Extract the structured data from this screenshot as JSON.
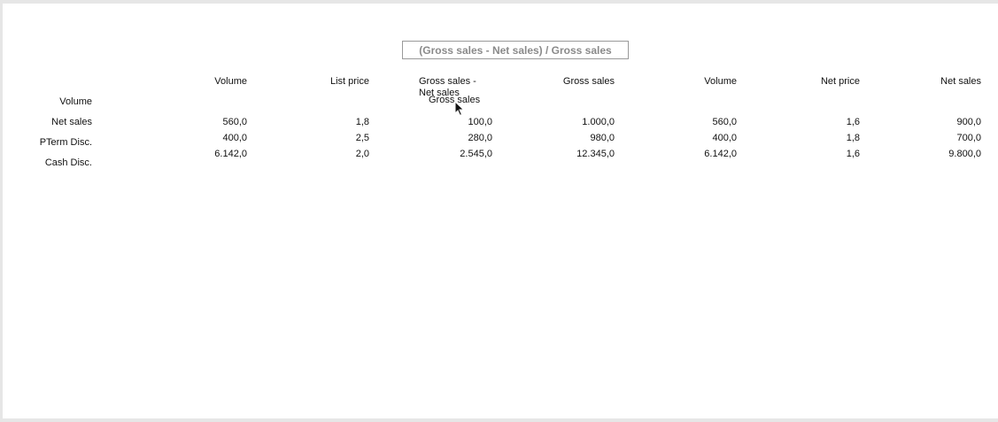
{
  "formula": {
    "label": "(Gross sales - Net sales) / Gross sales"
  },
  "columns": [
    "Volume",
    "List price",
    "Gross sales - Net sales",
    "Gross sales",
    "Volume",
    "Net price",
    "Net sales"
  ],
  "column_header_3_line1": "Gross sales -",
  "column_header_3_line2": "Net sales",
  "row_labels": [
    "Volume",
    "Net sales",
    "PTerm Disc.",
    "Cash Disc."
  ],
  "rows": [
    [
      "560,0",
      "1,8",
      "100,0",
      "1.000,0",
      "560,0",
      "1,6",
      "900,0"
    ],
    [
      "400,0",
      "2,5",
      "280,0",
      "980,0",
      "400,0",
      "1,8",
      "700,0"
    ],
    [
      "6.142,0",
      "2,0",
      "2.545,0",
      "12.345,0",
      "6.142,0",
      "1,6",
      "9.800,0"
    ]
  ],
  "drag_ghost_label": "Gross sales",
  "icons": {
    "cursor": "arrow-cursor-icon"
  }
}
